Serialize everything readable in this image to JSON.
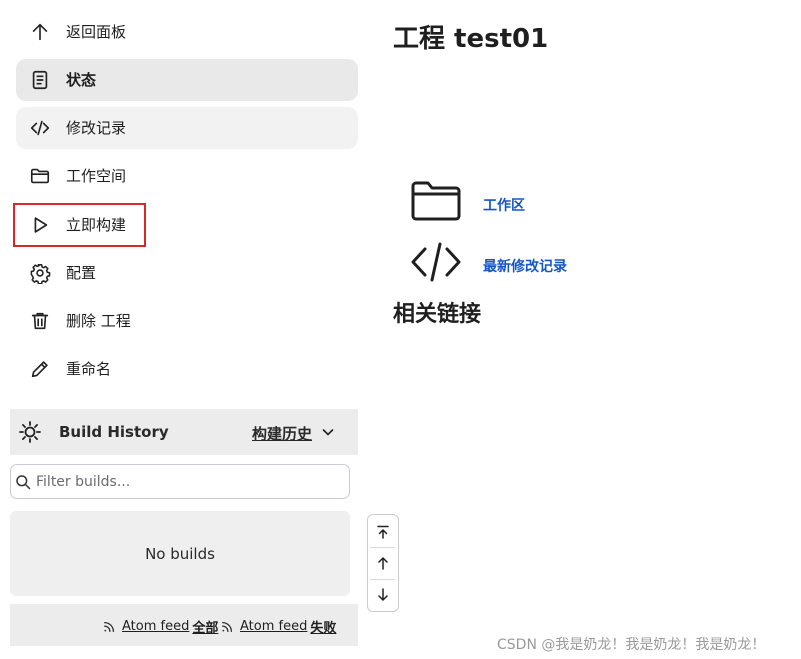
{
  "sidebar": {
    "items": [
      {
        "label": "返回面板",
        "icon": "arrow-up-icon"
      },
      {
        "label": "状态",
        "icon": "document-icon"
      },
      {
        "label": "修改记录",
        "icon": "code-icon"
      },
      {
        "label": "工作空间",
        "icon": "folder-icon"
      },
      {
        "label": "立即构建",
        "icon": "play-icon"
      },
      {
        "label": "配置",
        "icon": "gear-icon"
      },
      {
        "label": "删除 工程",
        "icon": "trash-icon"
      },
      {
        "label": "重命名",
        "icon": "pencil-icon"
      }
    ],
    "active_item": "状态",
    "highlighted_item": "立即构建",
    "highlight_color": "#d9262b"
  },
  "build_history": {
    "title": "Build History",
    "trend_label": "构建历史",
    "filter_placeholder": "Filter builds...",
    "empty_text": "No builds",
    "feeds": [
      {
        "label": "Atom feed",
        "scope": "全部"
      },
      {
        "label": "Atom feed",
        "scope": "失败"
      }
    ]
  },
  "main": {
    "title": "工程 test01",
    "links": [
      {
        "label": "工作区",
        "icon": "folder-icon"
      },
      {
        "label": "最新修改记录",
        "icon": "code-icon"
      }
    ],
    "related_title": "相关链接",
    "link_color": "#1556c8"
  },
  "watermark": "CSDN @我是奶龙！我是奶龙！我是奶龙！"
}
